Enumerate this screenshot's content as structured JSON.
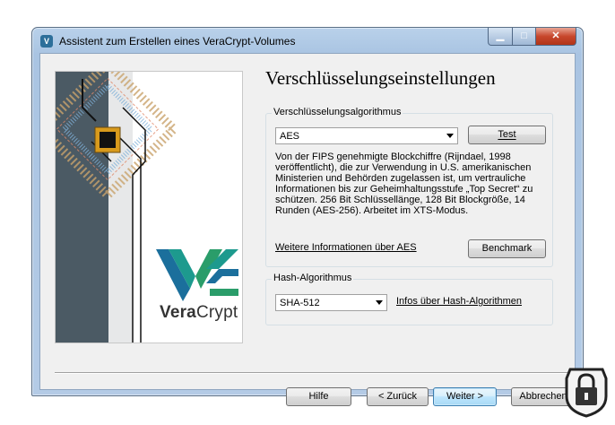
{
  "window": {
    "title": "Assistent zum Erstellen eines VeraCrypt-Volumes",
    "controls": {
      "minimize": "▁",
      "maximize": "□",
      "close": "✕"
    }
  },
  "sidebar": {
    "logo_text_bold": "Vera",
    "logo_text_normal": "Crypt"
  },
  "page_title": "Verschlüsselungseinstellungen",
  "encryption": {
    "legend": "Verschlüsselungsalgorithmus",
    "selected": "AES",
    "test_button": "Test",
    "description": "Von der FIPS genehmigte Blockchiffre (Rijndael, 1998 veröffentlicht), die zur Verwendung in U.S. amerikanischen Ministerien und Behörden zugelassen ist, um vertrauliche Informationen bis zur Geheimhaltungsstufe „Top Secret“ zu schützen. 256 Bit Schlüssellänge, 128 Bit Blockgröße, 14 Runden (AES-256). Arbeitet im XTS-Modus.",
    "more_info_link": "Weitere Informationen über AES",
    "benchmark_button": "Benchmark"
  },
  "hash": {
    "legend": "Hash-Algorithmus",
    "selected": "SHA-512",
    "info_link": "Infos über Hash-Algorithmen"
  },
  "footer": {
    "help": "Hilfe",
    "back": "< Zurück",
    "next": "Weiter >",
    "cancel": "Abbrechen"
  },
  "colors": {
    "accent": "#3c7fb1",
    "logo_teal": "#1d9a8e",
    "logo_blue": "#1b6f9c"
  }
}
